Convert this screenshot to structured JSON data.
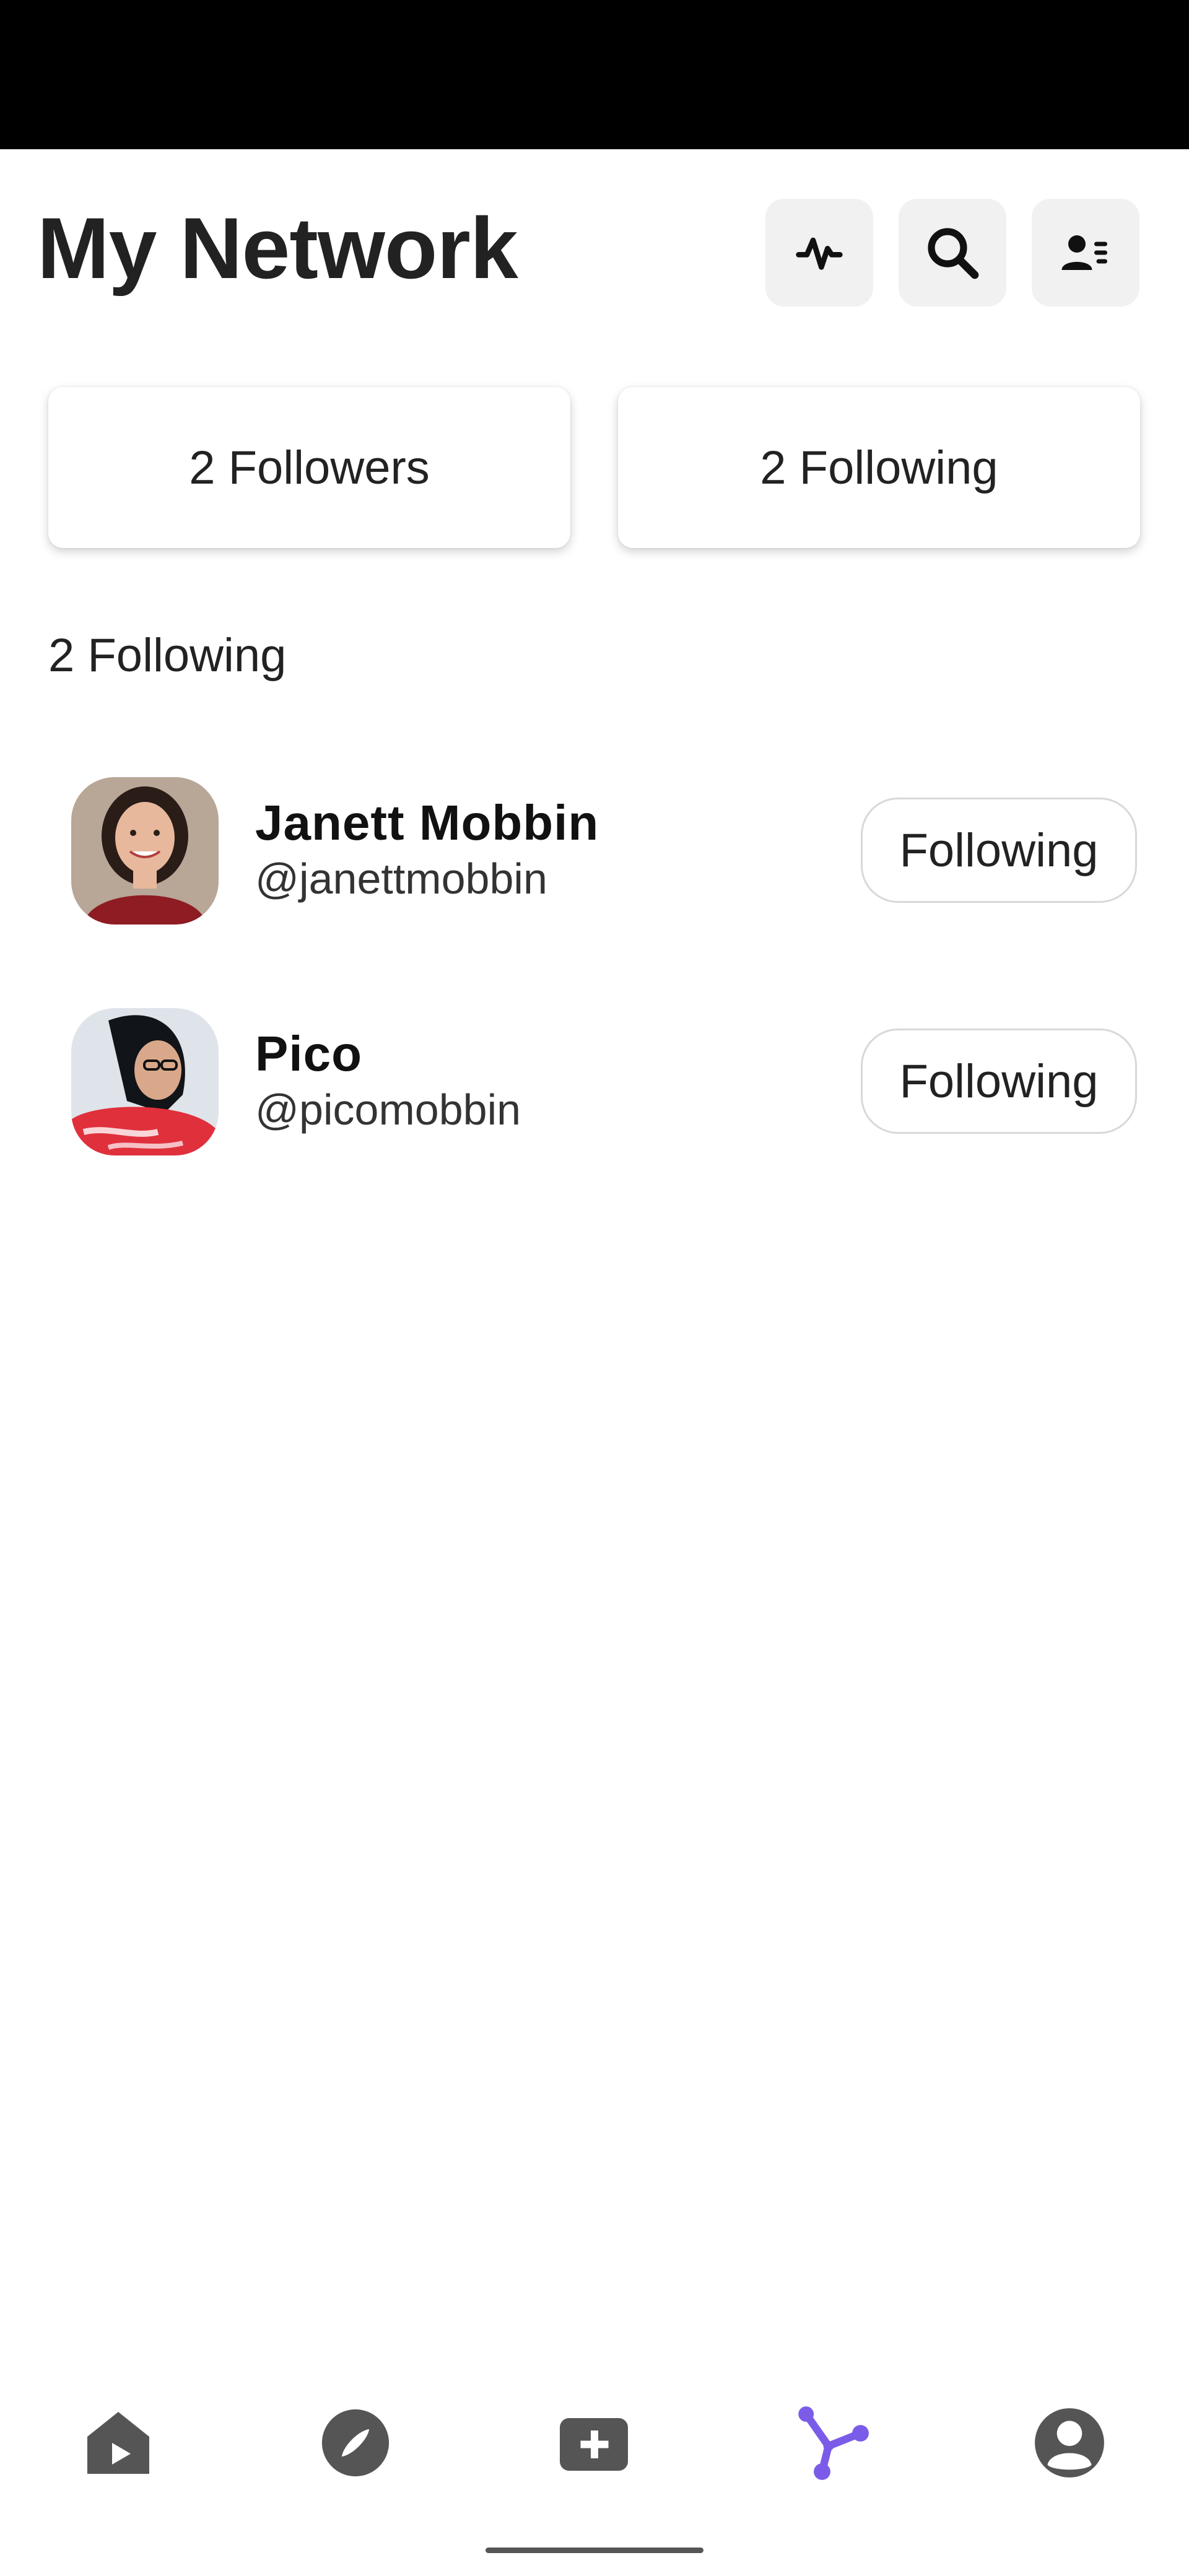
{
  "header": {
    "title": "My Network",
    "buttons": [
      {
        "icon": "activity-icon"
      },
      {
        "icon": "search-icon"
      },
      {
        "icon": "contacts-icon"
      }
    ]
  },
  "stats": {
    "followers_label": "2 Followers",
    "following_label": "2 Following"
  },
  "list": {
    "section_title": "2 Following",
    "items": [
      {
        "name": "Janett Mobbin",
        "handle": "@janettmobbin",
        "button_label": "Following"
      },
      {
        "name": "Pico",
        "handle": "@picomobbin",
        "button_label": "Following"
      }
    ]
  },
  "bottom_nav": {
    "items": [
      {
        "icon": "home-icon",
        "active": false
      },
      {
        "icon": "compass-icon",
        "active": false
      },
      {
        "icon": "add-icon",
        "active": false
      },
      {
        "icon": "network-icon",
        "active": true
      },
      {
        "icon": "profile-icon",
        "active": false
      }
    ],
    "colors": {
      "active": "#7b5ce8",
      "inactive": "#555555"
    }
  }
}
